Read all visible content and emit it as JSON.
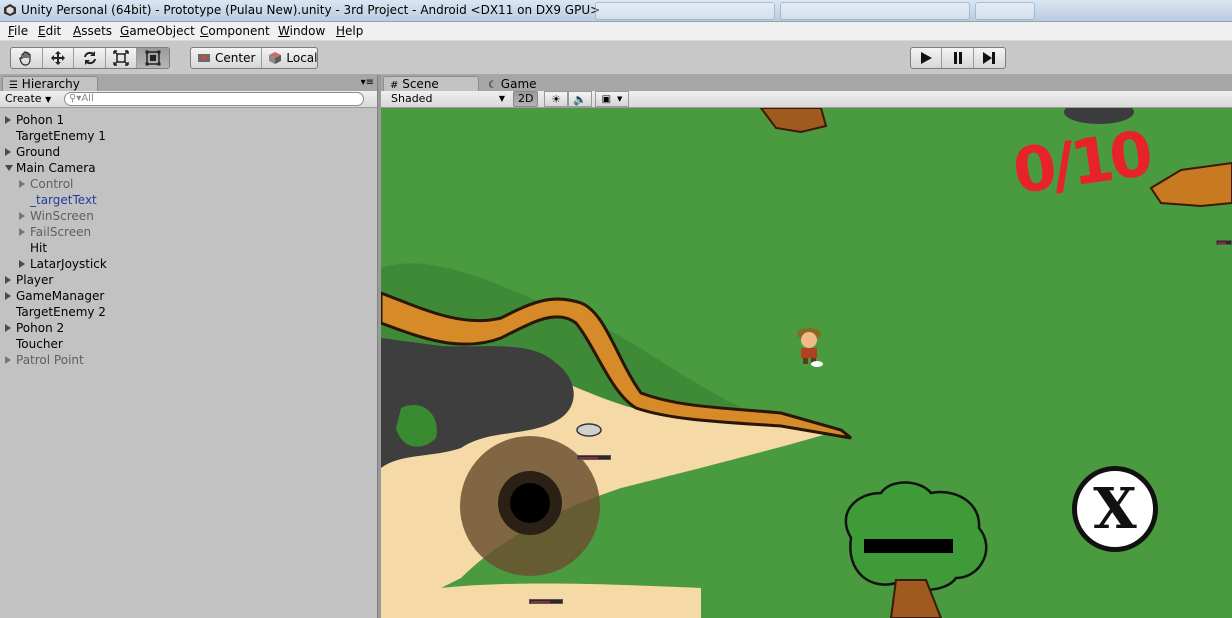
{
  "window": {
    "title": "Unity Personal (64bit) - Prototype (Pulau New).unity - 3rd Project - Android <DX11 on DX9 GPU>"
  },
  "menubar": {
    "items": [
      "File",
      "Edit",
      "Assets",
      "GameObject",
      "Component",
      "Window",
      "Help"
    ]
  },
  "toolbar": {
    "transform_tools": [
      "hand-tool",
      "move-tool",
      "rotate-tool",
      "scale-tool",
      "rect-tool"
    ],
    "active_tool": "rect-tool",
    "pivot_mode": "Center",
    "pivot_rotation": "Local",
    "play_controls": [
      "play",
      "pause",
      "step"
    ]
  },
  "hierarchy": {
    "tab_label": "Hierarchy",
    "create_label": "Create",
    "search_placeholder": "All",
    "items": [
      {
        "label": "Pohon 1",
        "indent": 0,
        "arrow": "collapsed",
        "state": "normal"
      },
      {
        "label": "TargetEnemy 1",
        "indent": 0,
        "arrow": "none",
        "state": "normal"
      },
      {
        "label": "Ground",
        "indent": 0,
        "arrow": "collapsed",
        "state": "normal"
      },
      {
        "label": "Main Camera",
        "indent": 0,
        "arrow": "expanded",
        "state": "normal"
      },
      {
        "label": "Control",
        "indent": 1,
        "arrow": "collapsed",
        "state": "inactive"
      },
      {
        "label": "_targetText",
        "indent": 1,
        "arrow": "none",
        "state": "linked"
      },
      {
        "label": "WinScreen",
        "indent": 1,
        "arrow": "collapsed",
        "state": "inactive"
      },
      {
        "label": "FailScreen",
        "indent": 1,
        "arrow": "collapsed",
        "state": "inactive"
      },
      {
        "label": "Hit",
        "indent": 1,
        "arrow": "none",
        "state": "normal"
      },
      {
        "label": "LatarJoystick",
        "indent": 1,
        "arrow": "collapsed",
        "state": "normal"
      },
      {
        "label": "Player",
        "indent": 0,
        "arrow": "collapsed",
        "state": "normal"
      },
      {
        "label": "GameManager",
        "indent": 0,
        "arrow": "collapsed",
        "state": "normal"
      },
      {
        "label": "TargetEnemy 2",
        "indent": 0,
        "arrow": "none",
        "state": "normal"
      },
      {
        "label": "Pohon 2",
        "indent": 0,
        "arrow": "collapsed",
        "state": "normal"
      },
      {
        "label": "Toucher",
        "indent": 0,
        "arrow": "none",
        "state": "normal"
      },
      {
        "label": "Patrol Point",
        "indent": 0,
        "arrow": "collapsed",
        "state": "inactive"
      }
    ]
  },
  "scene_view": {
    "tabs": [
      "Scene",
      "Game"
    ],
    "active_tab": "Scene",
    "draw_mode": "Shaded",
    "mode_2d_label": "2D",
    "game": {
      "score_text": "0/10",
      "action_button_label": "X"
    }
  },
  "colors": {
    "grass": "#4a9a40",
    "score": "#e8222a",
    "panel": "#c2c2c2"
  }
}
